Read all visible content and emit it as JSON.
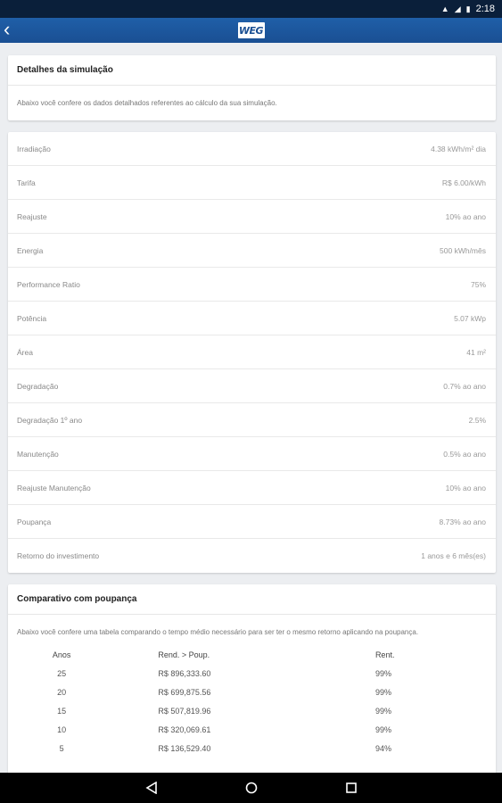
{
  "status_bar": {
    "time": "2:18"
  },
  "app_bar": {
    "back_icon": "chevron-left-icon",
    "logo_text": "WEG",
    "brand_color": "#1a4f93"
  },
  "details_card": {
    "title": "Detalhes da simulação",
    "description": "Abaixo você confere os dados detalhados referentes ao cálculo da sua simulação."
  },
  "details_rows": [
    {
      "label": "Irradiação",
      "value": "4.38 kWh/m² dia"
    },
    {
      "label": "Tarifa",
      "value": "R$ 6.00/kWh"
    },
    {
      "label": "Reajuste",
      "value": "10% ao ano"
    },
    {
      "label": "Energia",
      "value": "500 kWh/mês"
    },
    {
      "label": "Performance Ratio",
      "value": "75%"
    },
    {
      "label": "Potência",
      "value": "5.07 kWp"
    },
    {
      "label": "Área",
      "value": "41 m²"
    },
    {
      "label": "Degradação",
      "value": "0.7% ao ano"
    },
    {
      "label": "Degradação 1º ano",
      "value": "2.5%"
    },
    {
      "label": "Manutenção",
      "value": "0.5% ao ano"
    },
    {
      "label": "Reajuste Manutenção",
      "value": "10% ao ano"
    },
    {
      "label": "Poupança",
      "value": "8.73% ao ano"
    },
    {
      "label": "Retorno do investimento",
      "value": "1 anos e 6 mês(es)"
    }
  ],
  "comparison_card": {
    "title": "Comparativo com poupança",
    "description": "Abaixo você confere uma tabela comparando o tempo médio necessário para ser ter o mesmo retorno aplicando na poupança.",
    "headers": [
      "Anos",
      "Rend. > Poup.",
      "Rent."
    ],
    "rows": [
      {
        "anos": "25",
        "rend": "R$ 896,333.60",
        "rent": "99%"
      },
      {
        "anos": "20",
        "rend": "R$ 699,875.56",
        "rent": "99%"
      },
      {
        "anos": "15",
        "rend": "R$ 507,819.96",
        "rent": "99%"
      },
      {
        "anos": "10",
        "rend": "R$ 320,069.61",
        "rent": "99%"
      },
      {
        "anos": "5",
        "rend": "R$ 136,529.40",
        "rent": "94%"
      }
    ]
  }
}
